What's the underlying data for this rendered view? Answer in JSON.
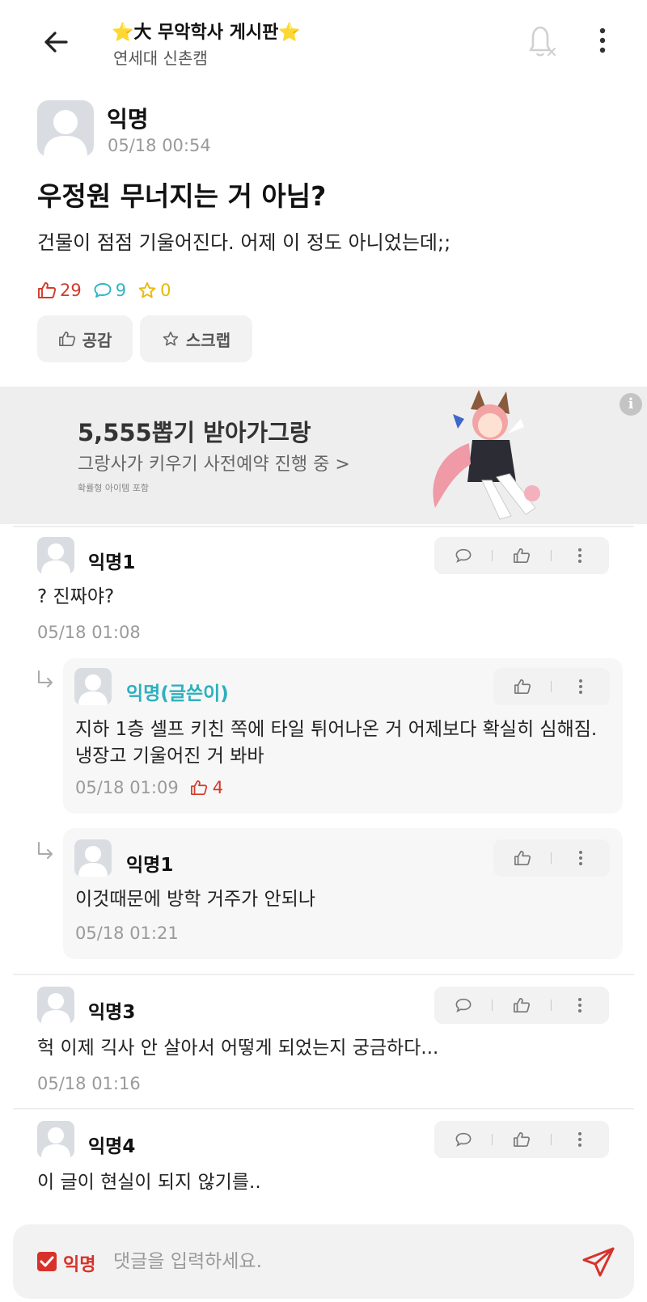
{
  "header": {
    "board_title": "⭐大 무악학사 게시판⭐",
    "board_subtitle": "연세대 신촌캠",
    "icons": [
      "back-arrow-icon",
      "bell-off-icon",
      "more-vertical-icon"
    ]
  },
  "post": {
    "author": "익명",
    "timestamp": "05/18 00:54",
    "title": "우정원 무너지는 거 아님?",
    "body": "건물이 점점 기울어진다. 어제 이 정도 아니었는데;;",
    "like_count": "29",
    "comment_count": "9",
    "scrap_count": "0",
    "like_button": "공감",
    "scrap_button": "스크랩"
  },
  "ad": {
    "title": "5,555뽑기 받아가그랑",
    "subtitle": "그랑사가 키우기 사전예약 진행 중 >",
    "note": "확률형 아이템 포함",
    "info_icon": "i"
  },
  "comments": [
    {
      "author": "익명1",
      "text": "? 진짜야?",
      "timestamp": "05/18 01:08"
    },
    {
      "author": "익명(글쓴이)",
      "text": "지하 1층 셀프 키친 쪽에 타일 튀어나온 거 어제보다 확실히 심해짐. 냉장고 기울어진 거 봐바",
      "timestamp": "05/18 01:09",
      "likes": "4"
    },
    {
      "author": "익명1",
      "text": "이것때문에 방학 거주가 안되나",
      "timestamp": "05/18 01:21"
    },
    {
      "author": "익명3",
      "text": "헉 이제 긱사 안 살아서 어떻게 되었는지 궁금하다...",
      "timestamp": "05/18 01:16"
    },
    {
      "author": "익명4",
      "text": "이 글이 현실이 되지 않기를..",
      "timestamp": ""
    }
  ],
  "comment_bar": {
    "anonymous_label": "익명",
    "anonymous_checked": true,
    "placeholder": "댓글을 입력하세요."
  },
  "colors": {
    "like_red": "#d23b2a",
    "comment_teal": "#2fb4c4",
    "scrap_yellow": "#e8b90a",
    "op_teal": "#2db0be",
    "accent_red": "#d7322a"
  }
}
